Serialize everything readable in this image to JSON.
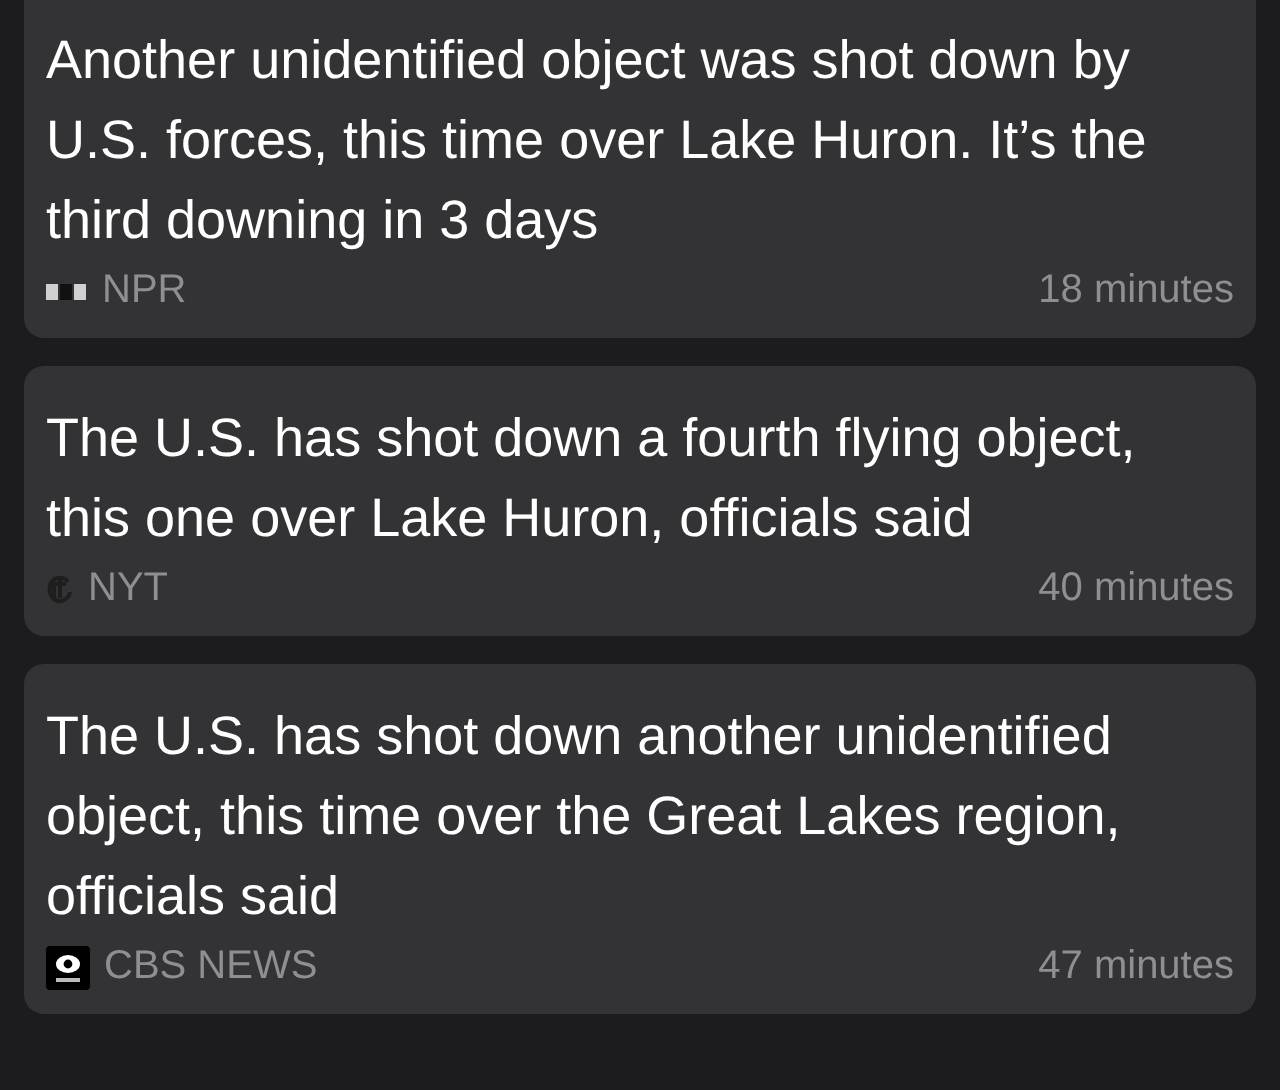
{
  "stories": [
    {
      "headline": "Another unidentified object was shot down by U.S. forces, this time over Lake Huron. It’s the third downing in 3 days",
      "source": "NPR",
      "logo": {
        "kind": "npr"
      },
      "time": "18 minutes"
    },
    {
      "headline": "The U.S. has shot down a fourth flying object, this one over Lake Huron, officials said",
      "source": "NYT",
      "logo": {
        "kind": "nyt"
      },
      "time": "40 minutes"
    },
    {
      "headline": "The U.S. has shot down another unidentified object, this time over the Great Lakes region, officials said",
      "source": "CBS NEWS",
      "logo": {
        "kind": "cbs"
      },
      "time": "47 minutes"
    }
  ]
}
